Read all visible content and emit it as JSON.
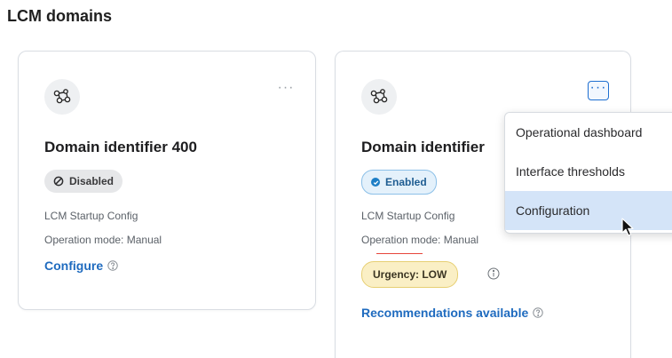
{
  "page": {
    "title": "LCM domains"
  },
  "cards": [
    {
      "title": "Domain identifier 400",
      "status": "Disabled",
      "config": "LCM Startup Config",
      "mode": "Operation mode: Manual",
      "link": "Configure",
      "more": "···"
    },
    {
      "title": "Domain identifier",
      "status": "Enabled",
      "config": "LCM Startup Config",
      "mode": "Operation mode: Manual",
      "urgency": "Urgency: LOW",
      "link": "Recommendations available",
      "more": "···"
    }
  ],
  "menu": {
    "items": [
      "Operational dashboard",
      "Interface thresholds",
      "Configuration"
    ],
    "active_index": 2
  },
  "icons": {
    "domain": "network-nodes-icon",
    "more": "more-options-icon",
    "help": "help-circle-icon",
    "info": "info-icon",
    "disabled": "disabled-circle-icon",
    "enabled": "check-circle-icon",
    "cursor": "mouse-cursor-icon"
  },
  "colors": {
    "link": "#1f6bbf",
    "enabled_bg": "#e4f1fb",
    "disabled_bg": "#e6e7e9",
    "urgency_bg": "#faefc5",
    "menu_active": "#d4e4f8"
  }
}
